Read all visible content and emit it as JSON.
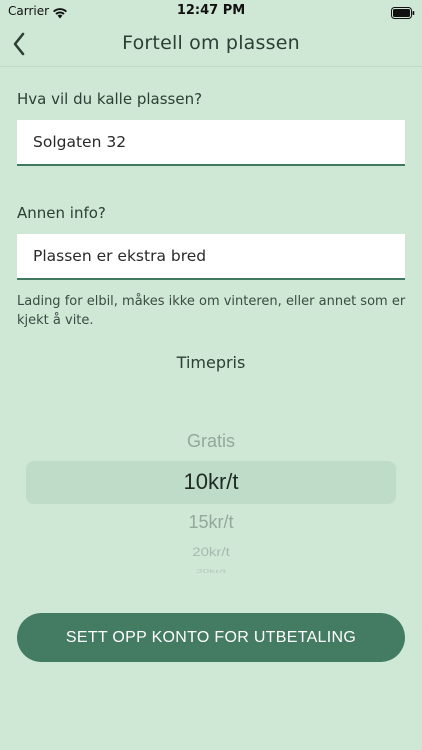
{
  "status_bar": {
    "carrier": "Carrier",
    "time": "12:47 PM",
    "wifi_icon": "wifi-icon",
    "battery_icon": "battery-full-icon"
  },
  "nav": {
    "back_icon": "chevron-left-icon",
    "title": "Fortell om plassen"
  },
  "form": {
    "name_label": "Hva vil du kalle plassen?",
    "name_value": "Solgaten 32",
    "info_label": "Annen info?",
    "info_value": "Plassen er ekstra bred",
    "helper_text": "Lading for elbil, måkes ikke om vinteren, eller annet som er kjekt å vite."
  },
  "price": {
    "title": "Timepris",
    "options": [
      "Gratis",
      "10kr/t",
      "15kr/t",
      "20kr/t",
      "30kr/t"
    ],
    "selected": "10kr/t"
  },
  "actions": {
    "setup_payout_label": "SETT OPP KONTO FOR UTBETALING"
  },
  "colors": {
    "background": "#cfe8d6",
    "accent": "#447b63",
    "picker_highlight": "#bedcc8",
    "field_underline": "#3f7a60"
  }
}
